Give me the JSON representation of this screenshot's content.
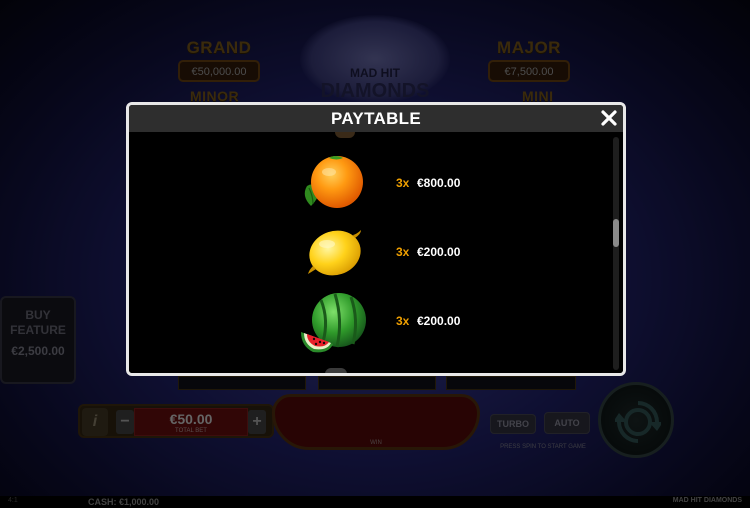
{
  "jackpots": {
    "grand": {
      "title": "GRAND",
      "value": "€50,000.00"
    },
    "major": {
      "title": "MAJOR",
      "value": "€7,500.00"
    },
    "minor": {
      "title": "MINOR"
    },
    "mini": {
      "title": "MINI"
    }
  },
  "logo": {
    "line1": "MAD HIT",
    "line2": "DIAMONDS"
  },
  "buy_feature": {
    "label_line1": "BUY",
    "label_line2": "FEATURE",
    "price": "€2,500.00"
  },
  "controls": {
    "info_label": "i",
    "minus_label": "−",
    "plus_label": "+",
    "bet_value": "€50.00",
    "bet_label": "TOTAL BET",
    "win_label": "WIN",
    "turbo_label": "TURBO",
    "auto_label": "AUTO",
    "hint": "PRESS SPIN TO START GAME"
  },
  "footer": {
    "cash": "CASH: €1,000.00",
    "game_name": "MAD HIT DIAMONDS",
    "clock": "4:1"
  },
  "paytable": {
    "title": "PAYTABLE",
    "close_label": "✕",
    "rows": [
      {
        "symbol": "orange",
        "multiplier": "3x",
        "payout": "€800.00"
      },
      {
        "symbol": "lemon",
        "multiplier": "3x",
        "payout": "€200.00"
      },
      {
        "symbol": "watermelon",
        "multiplier": "3x",
        "payout": "€200.00"
      }
    ]
  },
  "colors": {
    "multiplier": "#f0a000",
    "modal_border": "#e8e8e8",
    "modal_header": "#2e2e2e",
    "bet_box": "#5a0c0c"
  }
}
